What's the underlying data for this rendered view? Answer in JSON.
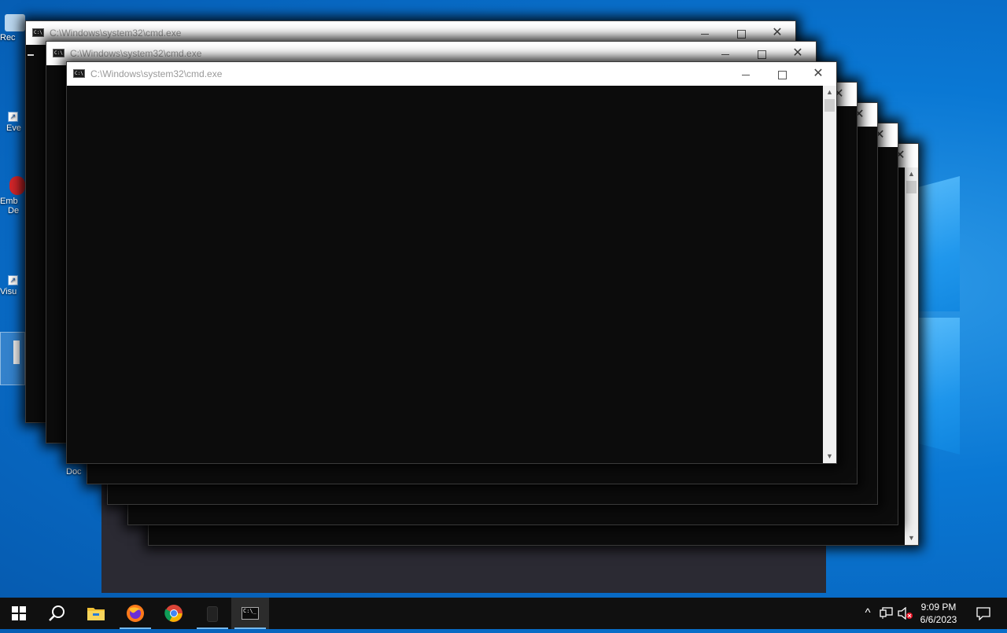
{
  "desktop": {
    "icons": [
      {
        "label": "Rec"
      },
      {
        "label": "Eve"
      },
      {
        "label": "Emb"
      },
      {
        "label": "De"
      },
      {
        "label": "Visu"
      },
      {
        "label": "Doc"
      }
    ]
  },
  "windows": [
    {
      "title": "C:\\Windows\\system32\\cmd.exe"
    },
    {
      "title": "C:\\Windows\\system32\\cmd.exe"
    },
    {
      "title": "C:\\Windows\\system32\\cmd.exe"
    }
  ],
  "window_controls": {
    "minimize_glyph": "—",
    "maximize_glyph": "☐",
    "close_glyph": "✕",
    "scroll_up_glyph": "▲",
    "scroll_down_glyph": "▼"
  },
  "taskbar": {
    "start_icon": "windows-start-icon",
    "search_icon": "search-icon",
    "pinned": [
      {
        "icon": "file-explorer-icon"
      },
      {
        "icon": "firefox-icon"
      },
      {
        "icon": "chrome-icon"
      },
      {
        "icon": "unknown-app-icon"
      },
      {
        "icon": "cmd-icon"
      }
    ],
    "tray": {
      "chevron": "^",
      "time": "9:09 PM",
      "date": "6/6/2023"
    }
  },
  "colors": {
    "cmd_background": "#0c0c0c",
    "titlebar": "#ffffff",
    "taskbar": "#101010",
    "desktop_blue": "#0a78d4"
  }
}
